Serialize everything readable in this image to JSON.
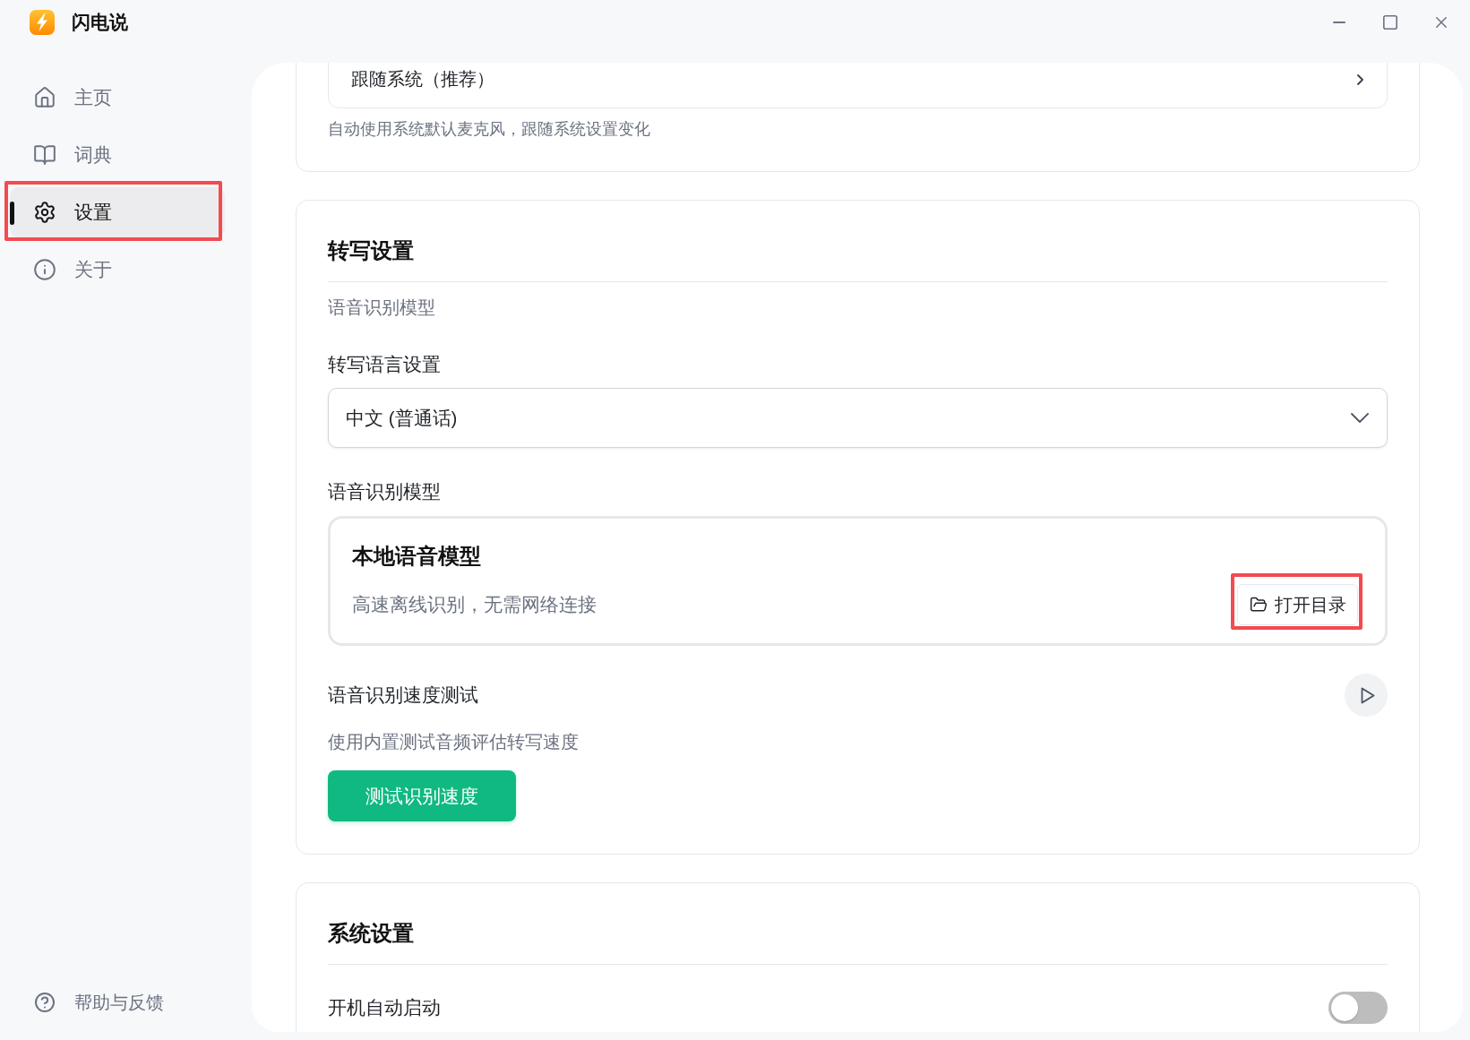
{
  "window": {
    "title": "闪电说"
  },
  "sidebar": {
    "items": [
      {
        "label": "主页",
        "selected": false,
        "highlighted": false
      },
      {
        "label": "词典",
        "selected": false,
        "highlighted": false
      },
      {
        "label": "设置",
        "selected": true,
        "highlighted": true
      },
      {
        "label": "关于",
        "selected": false,
        "highlighted": false
      }
    ],
    "help": {
      "label": "帮助与反馈"
    }
  },
  "microphone": {
    "value": "跟随系统（推荐）",
    "hint": "自动使用系统默认麦克风，跟随系统设置变化"
  },
  "transcription": {
    "title": "转写设置",
    "subtitle": "语音识别模型",
    "language": {
      "label": "转写语言设置",
      "value": "中文 (普通话)"
    },
    "model": {
      "label": "语音识别模型",
      "name": "本地语音模型",
      "description": "高速离线识别，无需网络连接",
      "button": {
        "label": "打开目录",
        "highlighted": true
      }
    },
    "speed_test": {
      "label": "语音识别速度测试",
      "hint": "使用内置测试音频评估转写速度",
      "button": "测试识别速度"
    }
  },
  "system": {
    "title": "系统设置",
    "rows": [
      {
        "label": "开机自动启动",
        "on": false
      }
    ]
  }
}
